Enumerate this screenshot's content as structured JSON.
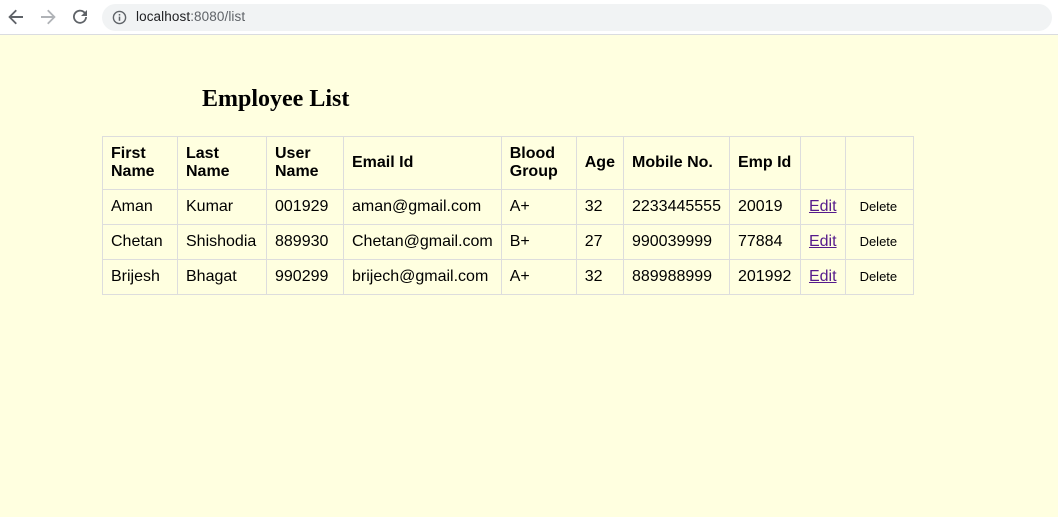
{
  "browser": {
    "url_host": "localhost",
    "url_path": ":8080/list",
    "icons": {
      "back": "back-arrow-icon",
      "forward": "forward-arrow-icon",
      "reload": "reload-icon",
      "info": "info-icon"
    }
  },
  "page": {
    "title": "Employee List",
    "background": "#ffffe0",
    "link_color": "#551a8b"
  },
  "table": {
    "headers": {
      "first_name": "First Name",
      "last_name": "Last Name",
      "user_name": "User Name",
      "email": "Email Id",
      "blood_group": "Blood Group",
      "age": "Age",
      "mobile": "Mobile No.",
      "emp_id": "Emp Id",
      "edit": "",
      "delete": ""
    },
    "rows": [
      {
        "first_name": "Aman",
        "last_name": "Kumar",
        "user_name": "001929",
        "email": "aman@gmail.com",
        "blood_group": "A+",
        "age": "32",
        "mobile": "2233445555",
        "emp_id": "20019",
        "edit_label": "Edit",
        "delete_label": "Delete"
      },
      {
        "first_name": "Chetan",
        "last_name": "Shishodia",
        "user_name": "889930",
        "email": "Chetan@gmail.com",
        "blood_group": "B+",
        "age": "27",
        "mobile": "990039999",
        "emp_id": "77884",
        "edit_label": "Edit",
        "delete_label": "Delete"
      },
      {
        "first_name": "Brijesh",
        "last_name": "Bhagat",
        "user_name": "990299",
        "email": "brijech@gmail.com",
        "blood_group": "A+",
        "age": "32",
        "mobile": "889988999",
        "emp_id": "201992",
        "edit_label": "Edit",
        "delete_label": "Delete"
      }
    ]
  }
}
